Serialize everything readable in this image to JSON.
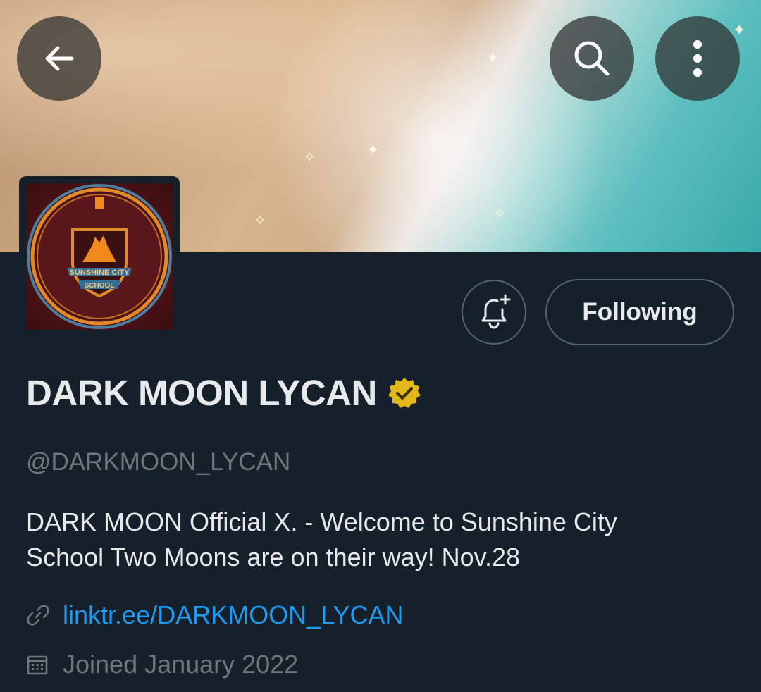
{
  "header": {
    "back_icon": "arrow-left-icon",
    "search_icon": "search-icon",
    "more_icon": "more-vertical-icon"
  },
  "avatar": {
    "crest_text_top": "SUNSHINE CITY",
    "crest_text_bottom": "SCHOOL"
  },
  "actions": {
    "notify_icon": "bell-plus-icon",
    "following_label": "Following"
  },
  "profile": {
    "name": "DARK MOON LYCAN",
    "verified_badge_color": "#e2b719",
    "handle": "@DARKMOON_LYCAN",
    "bio_line1": "DARK MOON Official X. - Welcome to Sunshine City",
    "bio_line2": "School Two Moons are on their way! Nov.28",
    "link": "linktr.ee/DARKMOON_LYCAN",
    "joined": "Joined January 2022"
  },
  "colors": {
    "background": "#15202b",
    "text_primary": "#e7e9ea",
    "text_secondary": "#71767b",
    "link": "#1d9bf0",
    "border": "#536471"
  }
}
